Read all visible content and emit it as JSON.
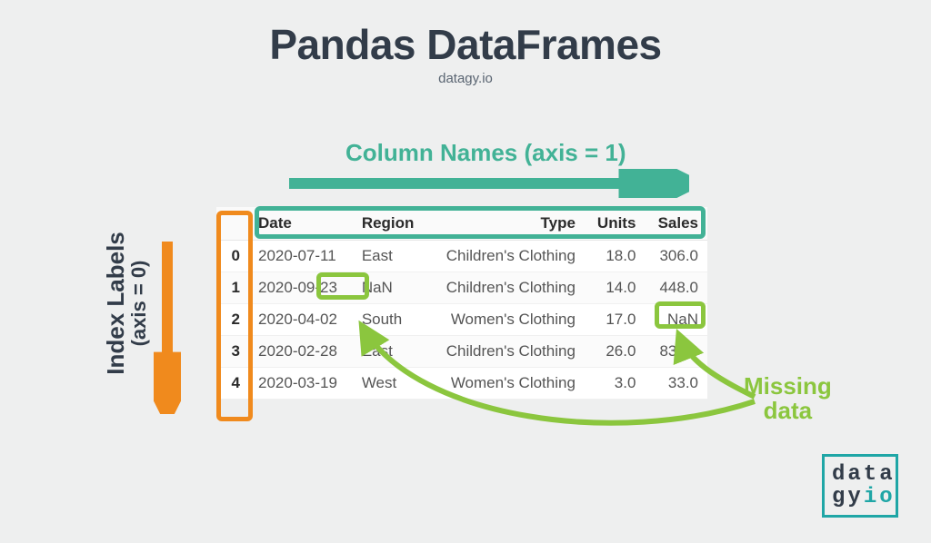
{
  "title": "Pandas DataFrames",
  "subtitle": "datagy.io",
  "labels": {
    "columns": "Column Names (axis = 1)",
    "index_line1": "Index Labels",
    "index_line2": "(axis = 0)",
    "missing_line1": "Missing",
    "missing_line2": "data"
  },
  "table": {
    "headers": {
      "date": "Date",
      "region": "Region",
      "type": "Type",
      "units": "Units",
      "sales": "Sales"
    },
    "rows": [
      {
        "idx": "0",
        "date": "2020-07-11",
        "region": "East",
        "type": "Children's Clothing",
        "units": "18.0",
        "sales": "306.0"
      },
      {
        "idx": "1",
        "date": "2020-09-23",
        "region": "NaN",
        "type": "Children's Clothing",
        "units": "14.0",
        "sales": "448.0"
      },
      {
        "idx": "2",
        "date": "2020-04-02",
        "region": "South",
        "type": "Women's Clothing",
        "units": "17.0",
        "sales": "NaN"
      },
      {
        "idx": "3",
        "date": "2020-02-28",
        "region": "East",
        "type": "Children's Clothing",
        "units": "26.0",
        "sales": "832.0"
      },
      {
        "idx": "4",
        "date": "2020-03-19",
        "region": "West",
        "type": "Women's Clothing",
        "units": "3.0",
        "sales": "33.0"
      }
    ]
  },
  "colors": {
    "teal": "#42b296",
    "orange": "#f08a1d",
    "green": "#8bc63e",
    "slate": "#323c49",
    "logo_teal": "#1fa6a6"
  },
  "logo": {
    "line1": "data",
    "gy": "gy",
    "io": "io"
  }
}
